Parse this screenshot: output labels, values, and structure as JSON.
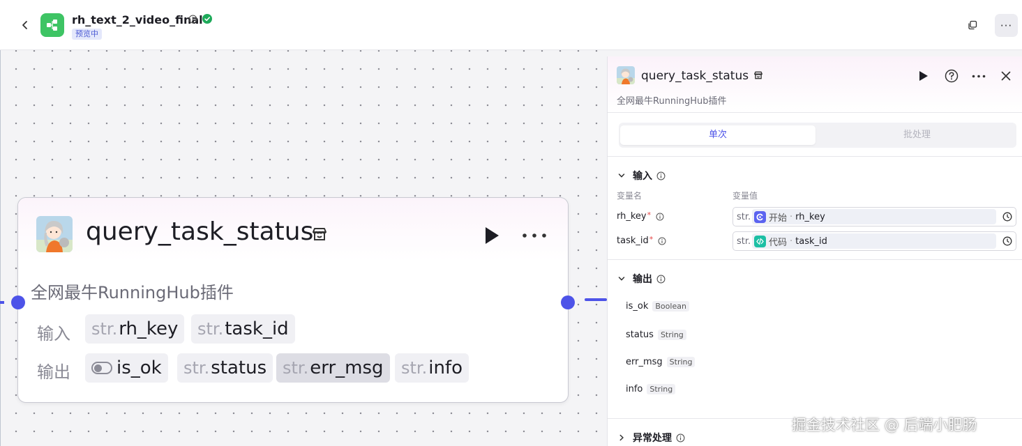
{
  "header": {
    "title": "rh_text_2_video_final",
    "badge": "预览中",
    "icons": [
      "chevron-left-icon",
      "workflow-logo-icon",
      "info-icon",
      "check-circle-icon",
      "copy-icon",
      "more-icon"
    ],
    "more_label": "···"
  },
  "node": {
    "title": "query_task_status",
    "description": "全网最牛RunningHub插件",
    "input_label": "输入",
    "output_label": "输出",
    "inputs": [
      {
        "type": "str.",
        "name": "rh_key"
      },
      {
        "type": "str.",
        "name": "task_id"
      }
    ],
    "outputs": [
      {
        "type": "",
        "name": "is_ok"
      },
      {
        "type": "str.",
        "name": "status"
      },
      {
        "type": "str.",
        "name": "err_msg"
      },
      {
        "type": "str.",
        "name": "info"
      }
    ],
    "accent": "#4d53e8"
  },
  "panel": {
    "title": "query_task_status",
    "description": "全网最牛RunningHub插件",
    "tabs": {
      "single": "单次",
      "batch": "批处理"
    },
    "input_section": {
      "title": "输入",
      "col_name": "变量名",
      "col_value": "变量值",
      "vars": [
        {
          "name": "rh_key",
          "type": "str.",
          "source": "开始",
          "sep": "·",
          "ref": "rh_key"
        },
        {
          "name": "task_id",
          "type": "str.",
          "source": "代码",
          "sep": "·",
          "ref": "task_id"
        }
      ]
    },
    "output_section": {
      "title": "输出",
      "vars": [
        {
          "name": "is_ok",
          "type": "Boolean"
        },
        {
          "name": "status",
          "type": "String"
        },
        {
          "name": "err_msg",
          "type": "String"
        },
        {
          "name": "info",
          "type": "String"
        }
      ]
    },
    "error_section": {
      "title": "异常处理"
    }
  },
  "watermark": "掘金技术社区 @ 后端小肥肠"
}
